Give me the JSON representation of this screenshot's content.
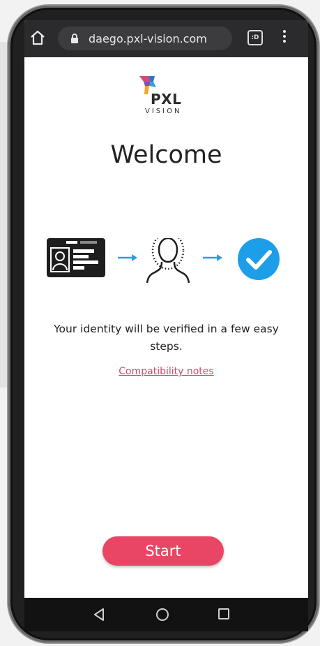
{
  "browser": {
    "url": "daego.pxl-vision.com",
    "tabs_count": ":D"
  },
  "logo": {
    "name": "PXL",
    "sub": "VISION"
  },
  "main": {
    "title": "Welcome",
    "description": "Your identity will be verified in a few easy steps.",
    "compat_link": "Compatibility notes",
    "start_label": "Start"
  },
  "steps": [
    "id-card-icon",
    "face-scan-icon",
    "check-circle-icon"
  ],
  "colors": {
    "accent": "#e84664",
    "link": "#d4486a",
    "check": "#1d9ee8",
    "arrow": "#2a9fd8"
  }
}
